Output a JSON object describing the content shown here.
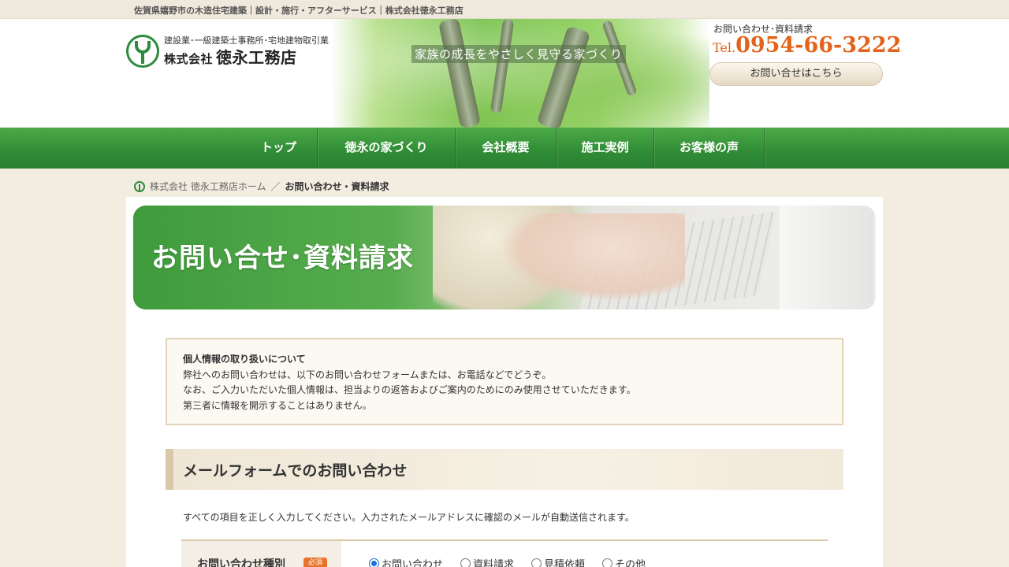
{
  "topbar": {
    "tagline": "佐賀県嬉野市の木造住宅建築｜設計・施行・アフターサービス｜株式会社徳永工務店"
  },
  "header": {
    "logo_sub": "建設業･一級建築士事務所･宅地建物取引業",
    "logo_company_prefix": "株式会社",
    "logo_company_name": "徳永工務店",
    "catchphrase": "家族の成長をやさしく見守る家づくり",
    "contact_label": "お問い合わせ･資料請求",
    "tel_prefix": "Tel.",
    "tel_number": "0954-66-3222",
    "contact_button": "お問い合せはこちら"
  },
  "nav": {
    "items": [
      "トップ",
      "徳永の家づくり",
      "会社概要",
      "施工実例",
      "お客様の声"
    ]
  },
  "breadcrumb": {
    "home": "株式会社 徳永工務店ホーム",
    "separator": "／",
    "current": "お問い合わせ・資料請求"
  },
  "banner": {
    "title": "お問い合せ･資料請求"
  },
  "privacy": {
    "title": "個人情報の取り扱いについて",
    "lines": [
      "弊社へのお問い合わせは、以下のお問い合わせフォームまたは、お電話などでどうぞ。",
      "なお、ご入力いただいた個人情報は、担当よりの返答およびご案内のためにのみ使用させていただきます。",
      "第三者に情報を開示することはありません。"
    ]
  },
  "form_section": {
    "heading": "メールフォームでのお問い合わせ",
    "intro": "すべての項目を正しく入力してください。入力されたメールアドレスに確認のメールが自動送信されます。",
    "row": {
      "label": "お問い合わせ種別",
      "badge": "必須",
      "options": [
        {
          "label": "お問い合わせ",
          "checked": true
        },
        {
          "label": "資料請求",
          "checked": false
        },
        {
          "label": "見積依頼",
          "checked": false
        },
        {
          "label": "その他",
          "checked": false
        }
      ]
    }
  },
  "colors": {
    "brand_green": "#2f8c35",
    "tel_orange": "#e2631a",
    "badge_orange": "#e8732a",
    "beige_border": "#e2d2b6"
  }
}
